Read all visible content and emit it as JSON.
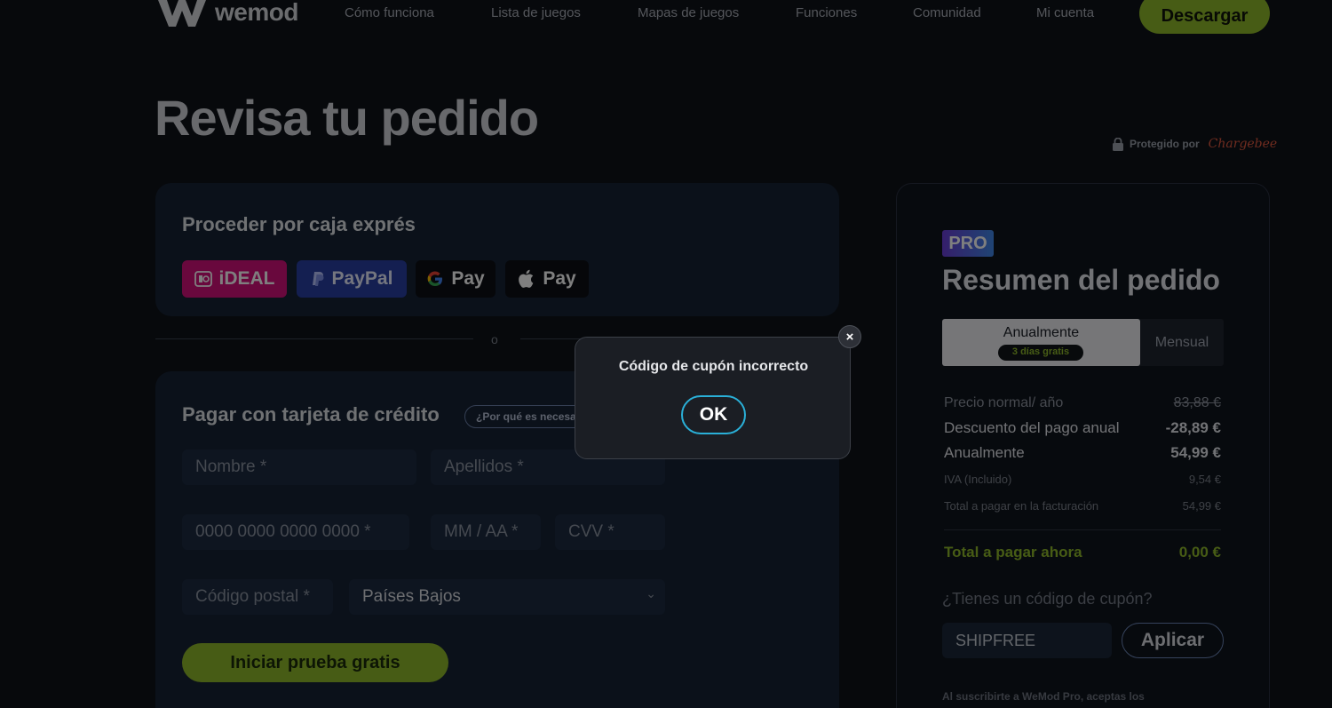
{
  "header": {
    "brand": "wemod",
    "nav": [
      "Cómo funciona",
      "Lista de juegos",
      "Mapas de juegos",
      "Funciones",
      "Comunidad",
      "Mi cuenta"
    ],
    "download_label": "Descargar"
  },
  "page": {
    "title": "Revisa tu pedido",
    "protected_label": "Protegido por",
    "protected_brand": "Chargebee"
  },
  "express": {
    "title": "Proceder por caja exprés",
    "methods": [
      "iDEAL",
      "PayPal",
      "Pay",
      "Pay"
    ]
  },
  "divider_label": "o",
  "card_form": {
    "title": "Pagar con tarjeta de crédito",
    "why_label": "¿Por qué es necesario?",
    "first_name_placeholder": "Nombre *",
    "last_name_placeholder": "Apellidos *",
    "card_number_placeholder": "0000 0000 0000 0000 *",
    "expiry_placeholder": "MM / AA *",
    "cvv_placeholder": "CVV *",
    "postal_placeholder": "Código postal *",
    "country_value": "Países Bajos",
    "submit_label": "Iniciar prueba gratis"
  },
  "summary": {
    "badge": "PRO",
    "title": "Resumen del pedido",
    "toggle_annual": "Anualmente",
    "toggle_annual_badge": "3 días gratis",
    "toggle_monthly": "Mensual",
    "rows": [
      {
        "label": "Precio normal/ año",
        "value": "83,88 €"
      },
      {
        "label": "Descuento del pago anual",
        "value": "-28,89 €"
      },
      {
        "label": "Anualmente",
        "value": "54,99 €"
      },
      {
        "label": "IVA (Incluido)",
        "value": "9,54 €"
      },
      {
        "label": "Total a pagar en la facturación",
        "value": "54,99 €"
      }
    ],
    "total_label": "Total a pagar ahora",
    "total_value": "0,00 €",
    "coupon_question": "¿Tienes un código de cupón?",
    "coupon_value": "SHIPFREE",
    "apply_label": "Aplicar",
    "legal": "Al suscribirte a WeMod Pro, aceptas los"
  },
  "modal": {
    "message": "Código de cupón incorrecto",
    "ok_label": "OK",
    "close_glyph": "×"
  },
  "colors": {
    "accent_green": "#8fb92b",
    "modal_ok_border": "#2ab0d8",
    "ideal": "#d3107a",
    "paypal": "#283ea3"
  }
}
